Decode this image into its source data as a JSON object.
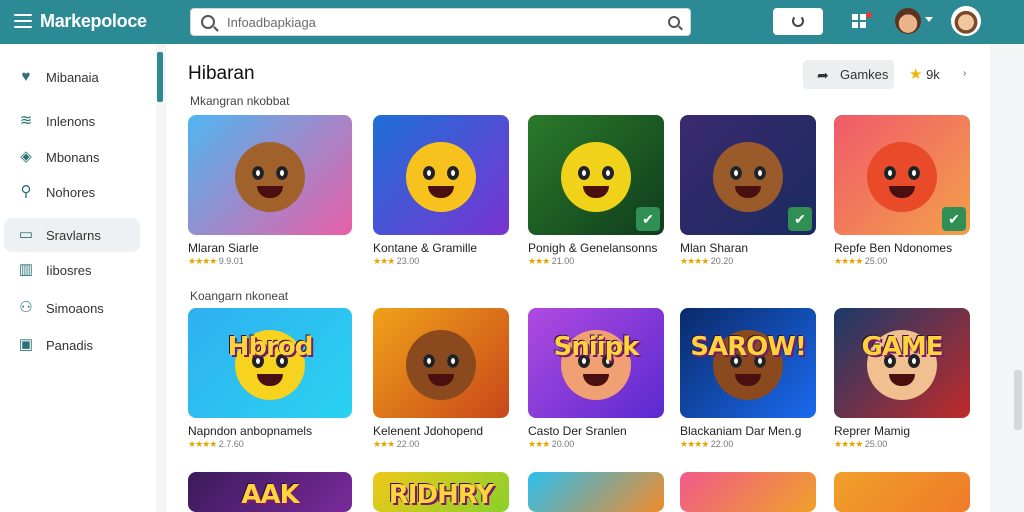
{
  "app": {
    "brand": "Markepoloce"
  },
  "search": {
    "placeholder": "Infoadbapkiaga"
  },
  "sidebar": {
    "items": [
      {
        "label": "Mibanaia",
        "icon": "heart-shield-icon"
      },
      {
        "label": "Inlenons",
        "icon": "wave-icon"
      },
      {
        "label": "Mbonans",
        "icon": "diamond-icon"
      },
      {
        "label": "Nohores",
        "icon": "location-pin-icon"
      },
      {
        "label": "Sravlarns",
        "icon": "folder-icon"
      },
      {
        "label": "Iibosres",
        "icon": "books-icon"
      },
      {
        "label": "Simoaons",
        "icon": "users-icon"
      },
      {
        "label": "Panadis",
        "icon": "lock-icon"
      }
    ]
  },
  "main": {
    "title": "Hibaran",
    "games_button": "Gamkes",
    "rating_value": "9k",
    "sections": [
      {
        "title": "Mkangran nkobbat",
        "cards": [
          {
            "name": "Mlaran Siarle",
            "stars": "★★★★",
            "meta": "9.9.01",
            "colors": [
              "#4fb6f0",
              "#e95fa8"
            ],
            "face": "#a0612a",
            "text": "",
            "badge": false
          },
          {
            "name": "Kontane & Gramille",
            "stars": "★★★",
            "meta": "23.00",
            "colors": [
              "#1d6fd6",
              "#7a34d2"
            ],
            "face": "#f7c21e",
            "text": "",
            "badge": false
          },
          {
            "name": "Ponigh & Genelansonns",
            "stars": "★★★",
            "meta": "21.00",
            "colors": [
              "#2a7a2a",
              "#0f3d1c"
            ],
            "face": "#f0d21a",
            "text": "",
            "badge": true
          },
          {
            "name": "Mlan Sharan",
            "stars": "★★★★",
            "meta": "20.20",
            "colors": [
              "#3a2a6e",
              "#1a2a60"
            ],
            "face": "#9a5a2a",
            "text": "",
            "badge": true
          },
          {
            "name": "Repfe Ben Ndonomes",
            "stars": "★★★★",
            "meta": "25.00",
            "colors": [
              "#f05a6a",
              "#f3a04a"
            ],
            "face": "#e84a2a",
            "text": "",
            "badge": true
          }
        ]
      },
      {
        "title": "Koangarn nkoneat",
        "cards": [
          {
            "name": "Napndon anbopnamels",
            "stars": "★★★★",
            "meta": "2.7.60",
            "colors": [
              "#2fb0f0",
              "#2ad2f0"
            ],
            "face": "#f7d21e",
            "text": "Hbrod",
            "badge": false
          },
          {
            "name": "Kelenent Jdohopend",
            "stars": "★★★",
            "meta": "22.00",
            "colors": [
              "#f0a21a",
              "#c8461a"
            ],
            "face": "#8a4a1e",
            "text": "",
            "badge": false
          },
          {
            "name": "Casto Der Sranlen",
            "stars": "★★★",
            "meta": "20.00",
            "colors": [
              "#b04ae0",
              "#5a2ad0"
            ],
            "face": "#f0a072",
            "text": "Sniipk",
            "badge": false
          },
          {
            "name": "Blackaniam Dar Men.g",
            "stars": "★★★★",
            "meta": "22.00",
            "colors": [
              "#0a2a6a",
              "#1a6af0"
            ],
            "face": "#8a4a1e",
            "text": "SAROW!",
            "badge": false
          },
          {
            "name": "Reprer Mamig",
            "stars": "★★★★",
            "meta": "25.00",
            "colors": [
              "#1a3a6a",
              "#c02a2a"
            ],
            "face": "#f0c090",
            "text": "GAME",
            "badge": false
          }
        ]
      },
      {
        "cards": [
          {
            "colors": [
              "#3a1a5a",
              "#7a2a9a"
            ],
            "text": "AAK"
          },
          {
            "colors": [
              "#f0c81a",
              "#8ad02a"
            ],
            "text": "RIDHRY"
          },
          {
            "colors": [
              "#2ac0f0",
              "#f08a2a"
            ],
            "text": ""
          },
          {
            "colors": [
              "#f05a8a",
              "#f0a02a"
            ],
            "text": ""
          },
          {
            "colors": [
              "#f0a02a",
              "#f07a2a"
            ],
            "text": ""
          }
        ]
      }
    ]
  }
}
